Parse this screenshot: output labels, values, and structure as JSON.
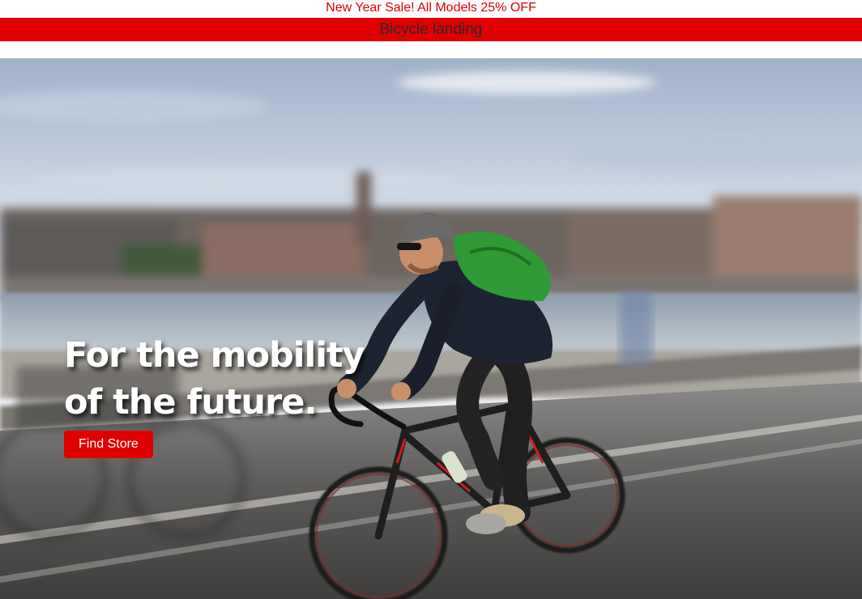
{
  "promo": {
    "text": "New Year Sale! All Models 25% OFF"
  },
  "header": {
    "title": "Bicycle landing"
  },
  "hero": {
    "title": "For the mobility of the future.",
    "cta_label": "Find Store"
  },
  "colors": {
    "accent": "#e00000",
    "header_text": "#2a2a2a",
    "hero_text": "#ffffff"
  }
}
